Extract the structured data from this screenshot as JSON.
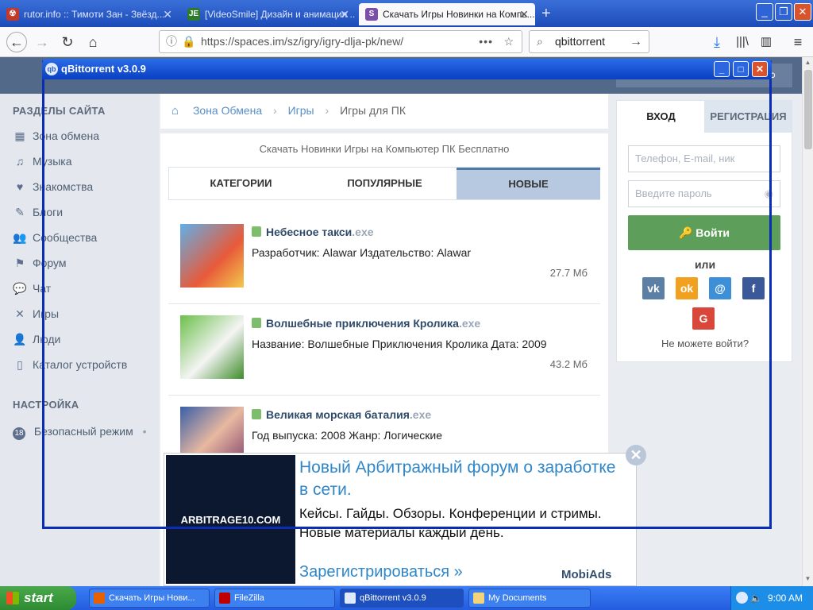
{
  "browser": {
    "tabs": [
      {
        "label": "rutor.info :: Тимоти Зан - Звёзд...",
        "icon": "rutor-icon"
      },
      {
        "label": "[VideoSmile] Дизайн и анимация ...",
        "icon": "videosmile-icon"
      },
      {
        "label": "Скачать Игры Новинки на Компь...",
        "icon": "spaces-icon"
      }
    ],
    "url": "https://spaces.im/sz/igry/igry-dlja-pk/new/",
    "search_value": "qbittorrent"
  },
  "site": {
    "sidebar_section1": "РАЗДЕЛЫ САЙТА",
    "sidebar_items": [
      {
        "label": "Зона обмена",
        "icon": "exchange-icon"
      },
      {
        "label": "Музыка",
        "icon": "music-icon"
      },
      {
        "label": "Знакомства",
        "icon": "heart-icon"
      },
      {
        "label": "Блоги",
        "icon": "pen-icon"
      },
      {
        "label": "Сообщества",
        "icon": "community-icon"
      },
      {
        "label": "Форум",
        "icon": "forum-icon"
      },
      {
        "label": "Чат",
        "icon": "chat-icon"
      },
      {
        "label": "Игры",
        "icon": "games-icon"
      },
      {
        "label": "Люди",
        "icon": "people-icon"
      },
      {
        "label": "Каталог устройств",
        "icon": "device-icon"
      }
    ],
    "sidebar_section2": "НАСТРОЙКА",
    "safe_mode_badge": "18",
    "safe_mode_label": "Безопасный режим",
    "breadcrumbs": [
      "Зона Обмена",
      "Игры",
      "Игры для ПК"
    ],
    "page_title": "Скачать Новинки Игры на Компьютер ПК Бесплатно",
    "tabs": [
      "КАТЕГОРИИ",
      "ПОПУЛЯРНЫЕ",
      "НОВЫЕ"
    ],
    "items": [
      {
        "name": "Небесное такси",
        "ext": ".exe",
        "desc": "Разработчик: Alawar Издательство: Alawar",
        "size": "27.7 Мб"
      },
      {
        "name": "Волшебные приключения Кролика",
        "ext": ".exe",
        "desc": "Название: Волшебные Приключения Кролика Дата: 2009",
        "size": "43.2 Мб"
      },
      {
        "name": "Великая морская баталия",
        "ext": ".exe",
        "desc": "Год выпуска: 2008 Жанр: Логические",
        "size": ""
      }
    ],
    "login": {
      "tab_login": "ВХОД",
      "tab_register": "РЕГИСТРАЦИЯ",
      "phone_placeholder": "Телефон, E-mail, ник",
      "password_placeholder": "Введите пароль",
      "button": "Войти",
      "or": "или",
      "cant_login": "Не можете войти?",
      "social": [
        "vk",
        "ok",
        "@",
        "f",
        "G"
      ]
    },
    "ad": {
      "headline": "Новый Арбитражный форум о заработке в сети.",
      "body": "Кейсы. Гайды. Обзоры. Конференции и стримы. Новые материалы каждый день.",
      "cta": "Зарегистрироваться »",
      "image_text": "ARBITRAGE10.COM",
      "brand": "MobiAds"
    }
  },
  "qbittorrent": {
    "title": "qBittorrent v3.0.9"
  },
  "taskbar": {
    "start": "start",
    "tasks": [
      "Скачать Игры Нови...",
      "FileZilla",
      "qBittorrent v3.0.9",
      "My Documents"
    ],
    "clock": "9:00 AM"
  },
  "colors": {
    "accent": "#5079a8",
    "login_green": "#5d9e5a",
    "xp_blue": "#245de0",
    "qb_border": "#0a2db8"
  }
}
